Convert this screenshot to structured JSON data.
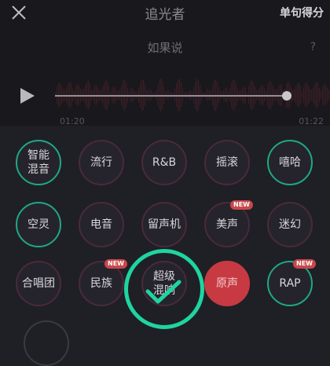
{
  "header": {
    "title": "追光者",
    "score_label": "单句得分",
    "subtitle": "如果说",
    "help_label": "?"
  },
  "player": {
    "time_start": "01:20",
    "time_end": "01:22",
    "progress": 0.99
  },
  "effects": [
    {
      "label": "智能混音",
      "accent": "green"
    },
    {
      "label": "流行"
    },
    {
      "label": "R&B"
    },
    {
      "label": "摇滚"
    },
    {
      "label": "嘻哈",
      "accent": "green"
    },
    {
      "label": "空灵",
      "accent": "green"
    },
    {
      "label": "电音"
    },
    {
      "label": "留声机"
    },
    {
      "label": "美声",
      "badge": "NEW"
    },
    {
      "label": "迷幻"
    },
    {
      "label": "合唱团"
    },
    {
      "label": "民族",
      "badge": "NEW"
    },
    {
      "label": "超级混响",
      "selected": true
    },
    {
      "label": "原声"
    },
    {
      "label": "RAP",
      "badge": "NEW",
      "accent": "green"
    }
  ],
  "colors": {
    "accent_green": "#1fd4a0",
    "accent_red": "#c73a42",
    "background": "#1f1f26"
  },
  "icons": {
    "close": "close-icon",
    "play": "play-icon",
    "selected": "checkmark-icon"
  }
}
